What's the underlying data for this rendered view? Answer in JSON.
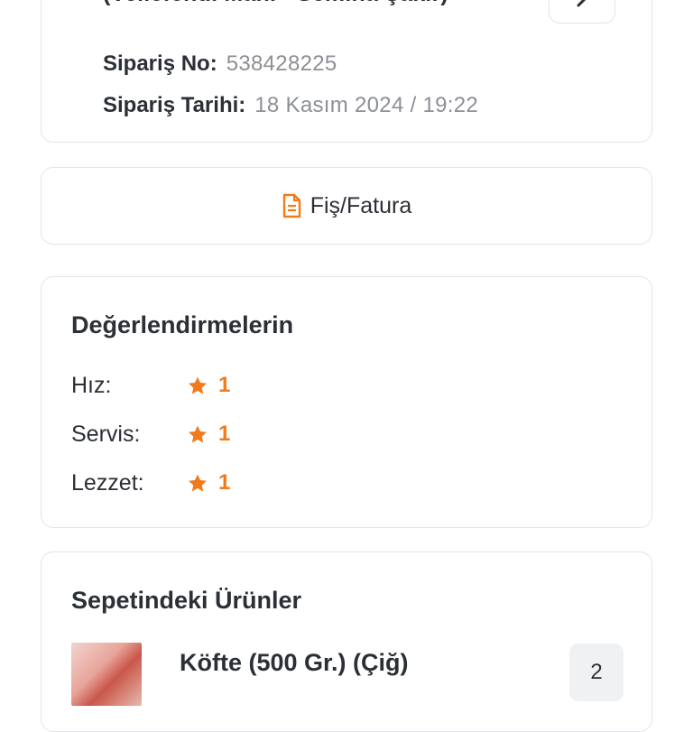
{
  "order": {
    "branch": "(Veliefendi Mah. - Semiha Şakir)",
    "order_no_label": "Sipariş No:",
    "order_no": "538428225",
    "order_date_label": "Sipariş Tarihi:",
    "order_date": "18 Kasım 2024 / 19:22",
    "arrow_icon": "chevron-right-icon"
  },
  "receipt": {
    "label": "Fiş/Fatura",
    "icon": "receipt-icon"
  },
  "ratings": {
    "title": "Değerlendirmelerin",
    "items": [
      {
        "label": "Hız:",
        "score": "1"
      },
      {
        "label": "Servis:",
        "score": "1"
      },
      {
        "label": "Lezzet:",
        "score": "1"
      }
    ],
    "star_color": "#f27a1a"
  },
  "cart": {
    "title": "Sepetindeki Ürünler",
    "items": [
      {
        "name": "Köfte (500 Gr.) (Çiğ)",
        "quantity": "2"
      }
    ]
  },
  "colors": {
    "accent": "#f27a1a",
    "muted_text": "#8c8f95",
    "border": "#e3e4e8"
  }
}
